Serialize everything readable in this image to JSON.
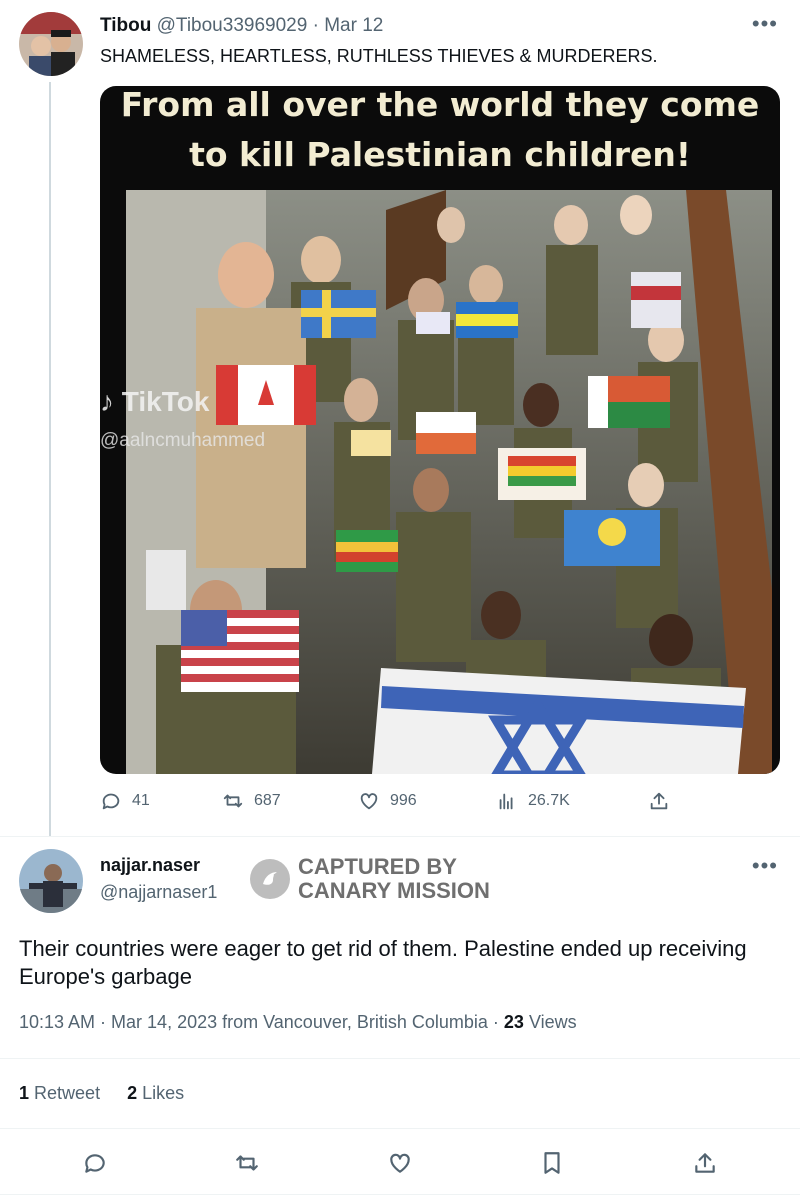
{
  "parent_tweet": {
    "display_name": "Tibou",
    "handle": "@Tibou33969029",
    "separator": "·",
    "date": "Mar 12",
    "text": "SHAMELESS, HEARTLESS, RUTHLESS THIEVES & MURDERERS.",
    "media": {
      "caption_line_1": "From all over the world they come",
      "caption_line_2": "to kill Palestinian children!",
      "watermark": "TikTok",
      "watermark_handle": "@aalncmuhammed"
    },
    "actions": {
      "replies": "41",
      "retweets": "687",
      "likes": "996",
      "views": "26.7K"
    }
  },
  "reply_tweet": {
    "display_name": "najjar.naser",
    "handle": "@najjarnaser1",
    "stamp_line_1": "CAPTURED BY",
    "stamp_line_2": "CANARY MISSION",
    "text": "Their countries were eager to get rid of them. Palestine ended up receiving Europe's garbage",
    "timestamp": "10:13 AM · Mar 14, 2023 from Vancouver, British Columbia ·",
    "views_count": "23",
    "views_label": "Views",
    "retweets_count": "1",
    "retweets_label": "Retweet",
    "likes_count": "2",
    "likes_label": "Likes"
  },
  "icons": {
    "more": "more-horizontal-icon",
    "reply": "comment-icon",
    "retweet": "retweet-icon",
    "like": "heart-icon",
    "views": "analytics-icon",
    "share": "share-icon",
    "bookmark": "bookmark-icon"
  },
  "colors": {
    "text_primary": "#0f1419",
    "text_secondary": "#536471",
    "divider": "#eff3f4"
  }
}
